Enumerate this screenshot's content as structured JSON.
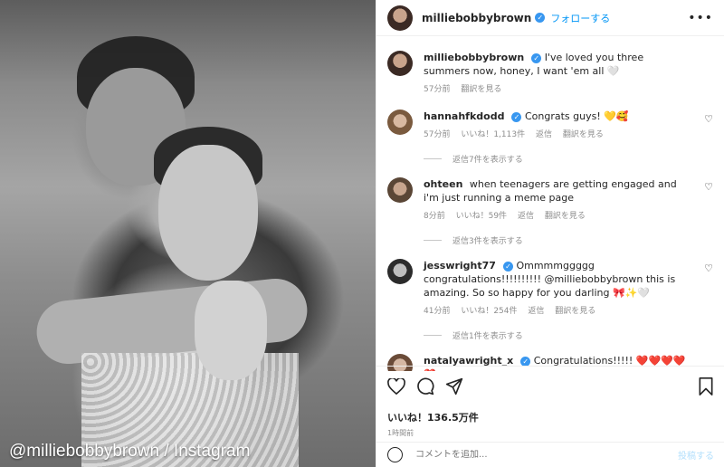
{
  "photo": {
    "credit": "@milliebobbybrown / Instagram"
  },
  "header": {
    "username": "milliebobbybrown",
    "verified_mark": "✓",
    "follow_label": "フォローする",
    "more_icon": "•••"
  },
  "caption": {
    "username": "milliebobbybrown",
    "text": "I've loved you three summers now, honey, I want 'em all 🤍",
    "time": "57分前",
    "translate": "翻訳を見る"
  },
  "comments": [
    {
      "username": "hannahfkdodd",
      "verified": true,
      "text": "Congrats guys! 💛🥰",
      "time": "57分前",
      "likes": "いいね！1,113件",
      "reply": "返信",
      "translate": "翻訳を見る",
      "replies": "返信7件を表示する"
    },
    {
      "username": "ohteen",
      "verified": false,
      "text": "when teenagers are getting engaged and i'm just running a meme page",
      "time": "8分前",
      "likes": "いいね！59件",
      "reply": "返信",
      "translate": "翻訳を見る",
      "replies": "返信3件を表示する"
    },
    {
      "username": "jesswright77",
      "verified": true,
      "text": "Ommmmggggg congratulations!!!!!!!!!! @milliebobbybrown this is amazing. So so happy for you darling 🎀✨🤍",
      "time": "41分前",
      "likes": "いいね！254件",
      "reply": "返信",
      "translate": "翻訳を見る",
      "replies": "返信1件を表示する"
    },
    {
      "username": "natalyawright_x",
      "verified": true,
      "text": "Congratulations!!!!! ❤️❤️❤️❤️❤️"
    }
  ],
  "actions": {
    "likes": "いいね！136.5万件",
    "time_ago": "1時間前"
  },
  "add_comment": {
    "placeholder": "コメントを追加...",
    "post_label": "投稿する"
  },
  "colors": {
    "link": "#0095f6",
    "verified": "#3897f0",
    "muted": "#8e8e8e"
  }
}
